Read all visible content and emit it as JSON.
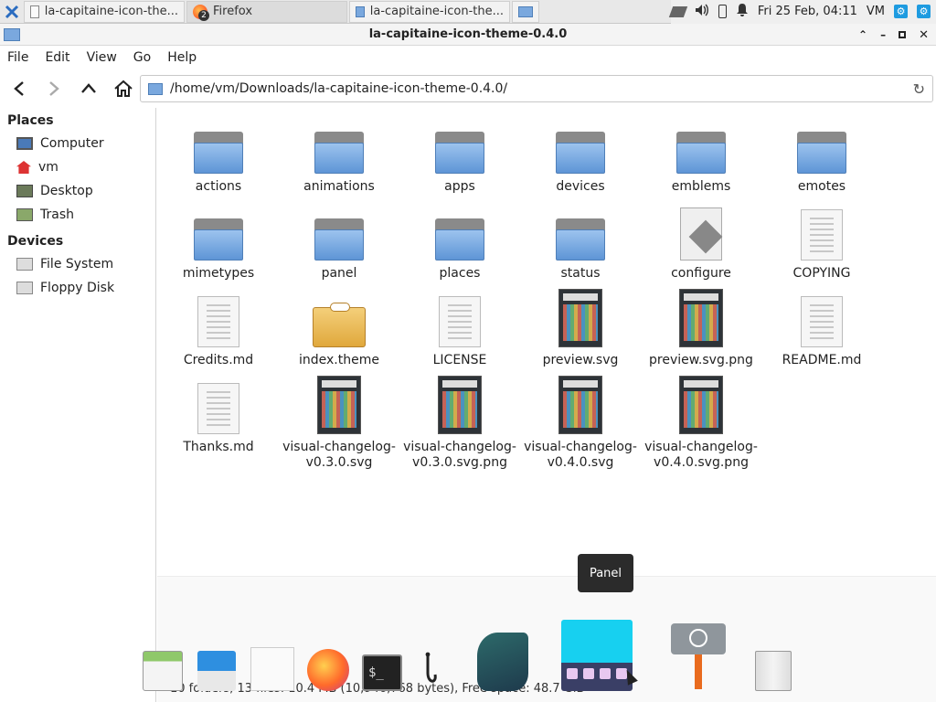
{
  "taskbar": {
    "tasks": [
      {
        "label": "la-capitaine-icon-the..."
      },
      {
        "label": "Firefox",
        "badge": "2"
      },
      {
        "label": "la-capitaine-icon-the..."
      }
    ],
    "clock": "Fri 25 Feb, 04:11",
    "user": "VM"
  },
  "window": {
    "title": "la-capitaine-icon-theme-0.4.0"
  },
  "menu": [
    "File",
    "Edit",
    "View",
    "Go",
    "Help"
  ],
  "location": {
    "path": "/home/vm/Downloads/la-capitaine-icon-theme-0.4.0/"
  },
  "sidebar": {
    "places_header": "Places",
    "places": [
      {
        "label": "Computer",
        "icon": "computer-icon"
      },
      {
        "label": "vm",
        "icon": "home-icon"
      },
      {
        "label": "Desktop",
        "icon": "desktop-icon"
      },
      {
        "label": "Trash",
        "icon": "trash-icon"
      }
    ],
    "devices_header": "Devices",
    "devices": [
      {
        "label": "File System",
        "icon": "drive-icon"
      },
      {
        "label": "Floppy Disk",
        "icon": "floppy-icon"
      }
    ]
  },
  "files": [
    {
      "name": "actions",
      "kind": "folder"
    },
    {
      "name": "animations",
      "kind": "folder"
    },
    {
      "name": "apps",
      "kind": "folder"
    },
    {
      "name": "devices",
      "kind": "folder"
    },
    {
      "name": "emblems",
      "kind": "folder"
    },
    {
      "name": "emotes",
      "kind": "folder"
    },
    {
      "name": "mimetypes",
      "kind": "folder"
    },
    {
      "name": "panel",
      "kind": "folder"
    },
    {
      "name": "places",
      "kind": "folder"
    },
    {
      "name": "status",
      "kind": "folder"
    },
    {
      "name": "configure",
      "kind": "script"
    },
    {
      "name": "COPYING",
      "kind": "text"
    },
    {
      "name": "Credits.md",
      "kind": "text"
    },
    {
      "name": "index.theme",
      "kind": "package"
    },
    {
      "name": "LICENSE",
      "kind": "text"
    },
    {
      "name": "preview.svg",
      "kind": "image"
    },
    {
      "name": "preview.svg.png",
      "kind": "image"
    },
    {
      "name": "README.md",
      "kind": "text"
    },
    {
      "name": "Thanks.md",
      "kind": "text"
    },
    {
      "name": "visual-changelog-v0.3.0.svg",
      "kind": "image"
    },
    {
      "name": "visual-changelog-v0.3.0.svg.png",
      "kind": "image"
    },
    {
      "name": "visual-changelog-v0.4.0.svg",
      "kind": "image"
    },
    {
      "name": "visual-changelog-v0.4.0.svg.png",
      "kind": "image"
    }
  ],
  "status_text": "10 folders, 13 files: 10.4 MB (10,946,768 bytes), Free space: 48.7 GiB",
  "tooltip": "Panel",
  "colors": {
    "folder": "#5e95d6",
    "dock_highlight": "#17d0f0"
  }
}
